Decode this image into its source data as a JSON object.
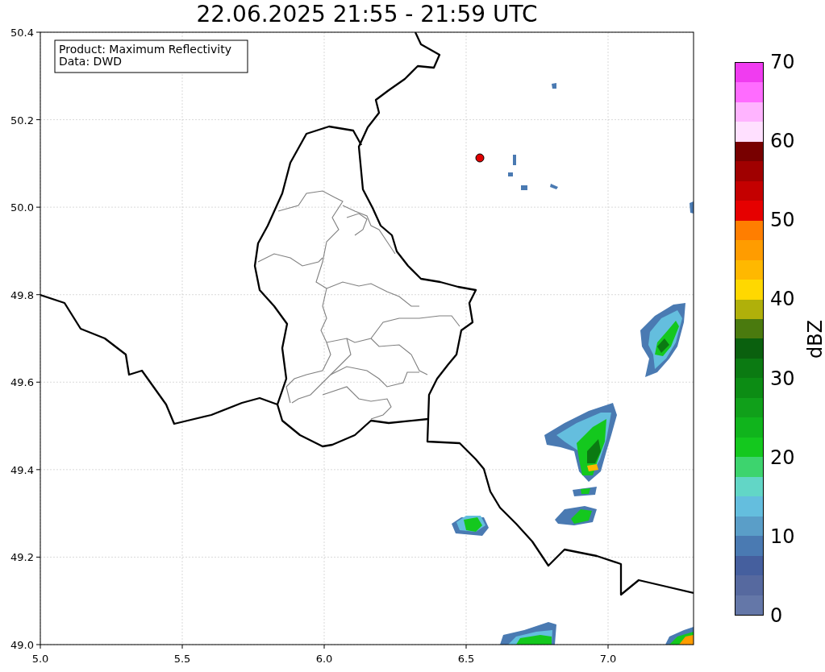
{
  "title": "22.06.2025 21:55 - 21:59 UTC",
  "map": {
    "info_box": [
      "Product: Maximum Reflectivity",
      "Data: DWD"
    ],
    "xticks": [
      "5.0",
      "5.5",
      "6.0",
      "6.5",
      "7.0"
    ],
    "yticks": [
      "50.4",
      "50.2",
      "50.0",
      "49.8",
      "49.6",
      "49.4",
      "49.2",
      "49.0"
    ]
  },
  "colorbar": {
    "label": "dBZ",
    "ticks": [
      "70",
      "60",
      "50",
      "40",
      "30",
      "20",
      "10",
      "0"
    ],
    "bands": [
      {
        "color": "#6477a8"
      },
      {
        "color": "#56699f"
      },
      {
        "color": "#455f9e"
      },
      {
        "color": "#4a7ab2"
      },
      {
        "color": "#5a9ec8"
      },
      {
        "color": "#64bede"
      },
      {
        "color": "#62d6c6"
      },
      {
        "color": "#3dd46e"
      },
      {
        "color": "#14c81e"
      },
      {
        "color": "#10b41c"
      },
      {
        "color": "#10a01a"
      },
      {
        "color": "#0c8c14"
      },
      {
        "color": "#0b7a12"
      },
      {
        "color": "#0a600e"
      },
      {
        "color": "#4a7a0e"
      },
      {
        "color": "#b0b00a"
      },
      {
        "color": "#ffd800"
      },
      {
        "color": "#ffb800"
      },
      {
        "color": "#ff9c00"
      },
      {
        "color": "#ff7e00"
      },
      {
        "color": "#e60000"
      },
      {
        "color": "#c40000"
      },
      {
        "color": "#a00000"
      },
      {
        "color": "#780000"
      },
      {
        "color": "#ffe0ff"
      },
      {
        "color": "#ffb4ff"
      },
      {
        "color": "#ff6cff"
      },
      {
        "color": "#f03cf0"
      }
    ]
  }
}
